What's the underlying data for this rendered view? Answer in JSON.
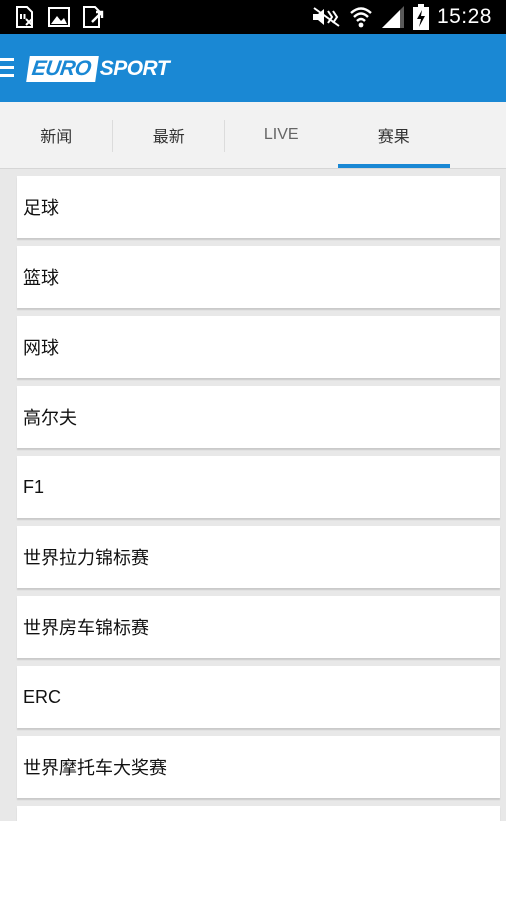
{
  "status_bar": {
    "time": "15:28",
    "icons": [
      "sd-card-icon",
      "image-icon",
      "download-icon",
      "mute-icon",
      "wifi-icon",
      "signal-icon",
      "battery-charging-icon"
    ]
  },
  "app_bar": {
    "logo_part1": "EURO",
    "logo_part2": "SPORT",
    "menu_icon": "hamburger-menu-icon",
    "color": "#1a88d4"
  },
  "tabs": [
    {
      "label": "新闻",
      "active": false
    },
    {
      "label": "最新",
      "active": false
    },
    {
      "label": "LIVE",
      "active": false
    },
    {
      "label": "赛果",
      "active": true
    }
  ],
  "list": {
    "items": [
      {
        "label": "足球"
      },
      {
        "label": "篮球"
      },
      {
        "label": "网球"
      },
      {
        "label": "高尔夫"
      },
      {
        "label": "F1"
      },
      {
        "label": "世界拉力锦标赛"
      },
      {
        "label": "世界房车锦标赛"
      },
      {
        "label": "ERC"
      },
      {
        "label": "世界摩托车大奖赛"
      },
      {
        "label": ""
      }
    ]
  }
}
